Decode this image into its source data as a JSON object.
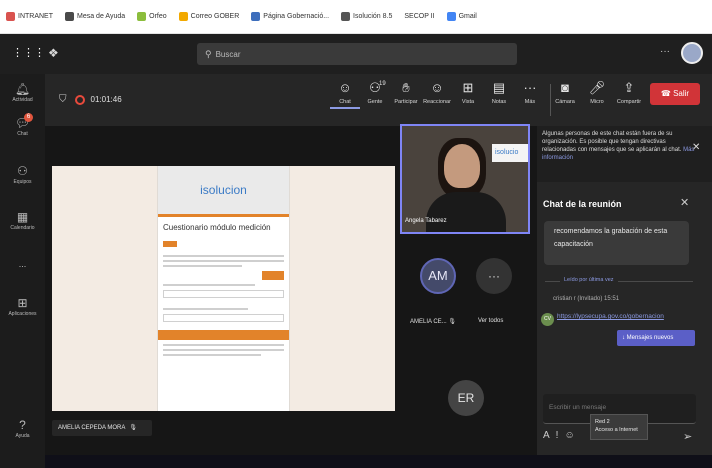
{
  "bookmarks": [
    {
      "label": "INTRANET",
      "color": "#d9534f"
    },
    {
      "label": "Mesa de Ayuda",
      "color": "#4a4a4a"
    },
    {
      "label": "Orfeo",
      "color": "#8bbd3c"
    },
    {
      "label": "Correo GOBER",
      "color": "#f2a900"
    },
    {
      "label": "Página Gobernació...",
      "color": "#3d6ebc"
    },
    {
      "label": "Isolución 8.5",
      "color": "#555555"
    },
    {
      "label": "SECOP II",
      "color": "#ffffff"
    },
    {
      "label": "Gmail",
      "color": "#4285f4"
    }
  ],
  "top": {
    "search_placeholder": "Buscar"
  },
  "rail": {
    "items": [
      "Actividad",
      "Chat",
      "Equipos",
      "Calendario",
      "...",
      "Aplicaciones",
      "Ayuda"
    ],
    "chat_badge": "6"
  },
  "meeting": {
    "timer": "01:01:46",
    "toolbar": {
      "chat": "Chat",
      "people": "Gente",
      "people_count": "19",
      "raise": "Participar",
      "react": "Reaccionar",
      "view": "Vista",
      "notes": "Notas",
      "more": "Más",
      "camera": "Cámara",
      "mic": "Micro",
      "share": "Compartir",
      "leave": "Salir"
    },
    "share": {
      "brand": "isolucion",
      "title": "Cuestionario módulo medición"
    },
    "presenter_name": "AMELIA CEPEDA MORA",
    "video_name": "Angela Tabarez",
    "sign_text": "isolucio",
    "am_initials": "AM",
    "am_name": "AMELIA CE...",
    "more_label": "Ver todos",
    "er_initials": "ER"
  },
  "chat": {
    "notice": "Algunas personas de este chat están fuera de su organización. Es posible que tengan directivas relacionadas con mensajes que se aplicarán al chat.",
    "notice_link": "Más información",
    "title": "Chat de la reunión",
    "bubble_text": "recomendamos la grabación de esta capacitación",
    "read_by": "Leído por última vez",
    "sender": "cristian r (Invitado) 15:51",
    "avatar_initials": "CV",
    "link_text": "https://lypsecupa.gov.co/gobernacion",
    "new_messages": "Mensajes nuevos",
    "compose_placeholder": "Escribir un mensaje",
    "tooltip_line1": "Red 2",
    "tooltip_line2": "Acceso a Internet"
  }
}
